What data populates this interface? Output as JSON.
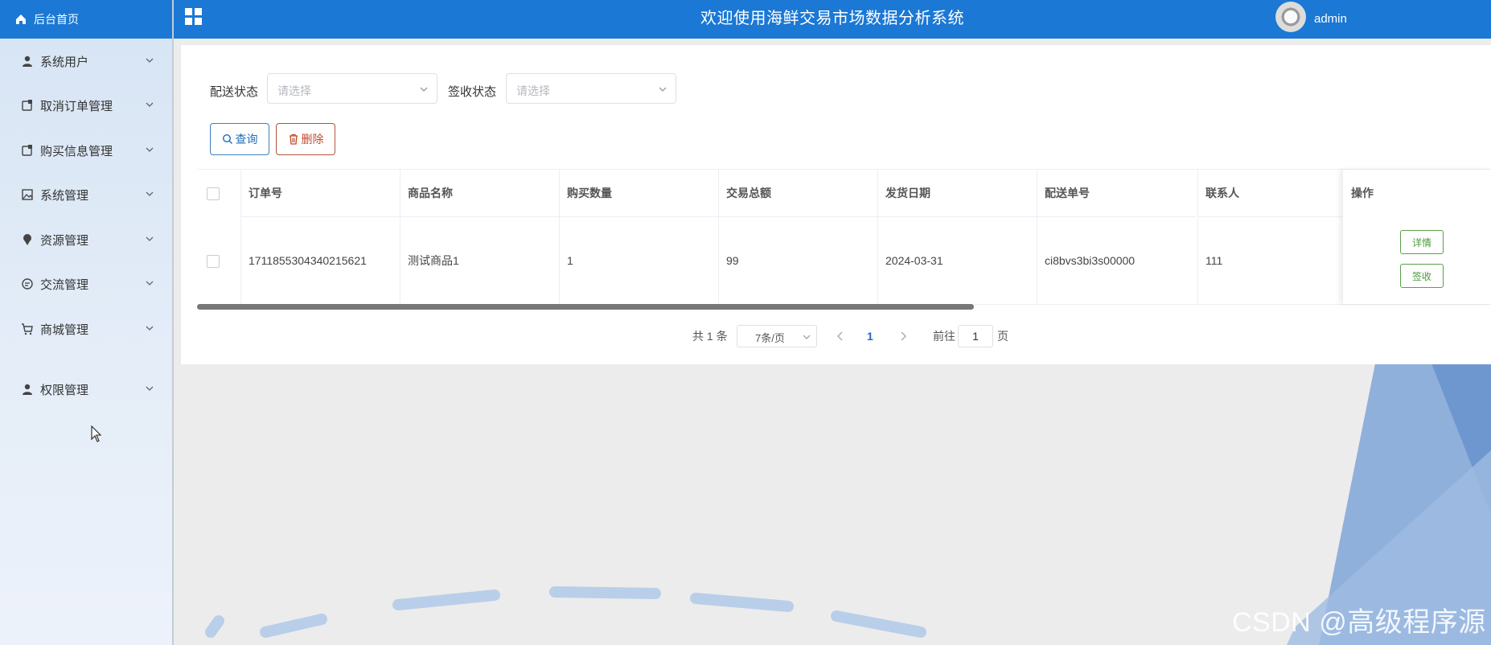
{
  "sidebar": {
    "home": "后台首页",
    "items": [
      {
        "label": "系统用户",
        "icon": "user-icon"
      },
      {
        "label": "取消订单管理",
        "icon": "doc-icon"
      },
      {
        "label": "购买信息管理",
        "icon": "doc-icon"
      },
      {
        "label": "系统管理",
        "icon": "picture-icon"
      },
      {
        "label": "资源管理",
        "icon": "pin-icon"
      },
      {
        "label": "交流管理",
        "icon": "chat-icon"
      },
      {
        "label": "商城管理",
        "icon": "cart-icon"
      },
      {
        "label": "权限管理",
        "icon": "user-icon"
      }
    ]
  },
  "header": {
    "title": "欢迎使用海鲜交易市场数据分析系统",
    "username": "admin"
  },
  "filters": {
    "delivery_label": "配送状态",
    "delivery_placeholder": "请选择",
    "sign_label": "签收状态",
    "sign_placeholder": "请选择"
  },
  "actions": {
    "query": "查询",
    "delete": "删除"
  },
  "table": {
    "columns": [
      "订单号",
      "商品名称",
      "购买数量",
      "交易总额",
      "发货日期",
      "配送单号",
      "联系人",
      "操作"
    ],
    "rows": [
      {
        "order_no": "1711855304340215621",
        "product": "测试商品1",
        "quantity": "1",
        "total": "99",
        "ship_date": "2024-03-31",
        "delivery_no": "ci8bvs3bi3s00000",
        "contact": "111",
        "detail": "详情",
        "sign": "签收"
      }
    ]
  },
  "pagination": {
    "total": "共 1 条",
    "page_size": "7条/页",
    "current": "1",
    "goto": "前往",
    "goto_value": "1",
    "unit": "页"
  },
  "watermark": "CSDN @高级程序源",
  "colors": {
    "primary": "#1b78d4",
    "success": "#4c9a3b",
    "danger": "#c24a2e"
  }
}
